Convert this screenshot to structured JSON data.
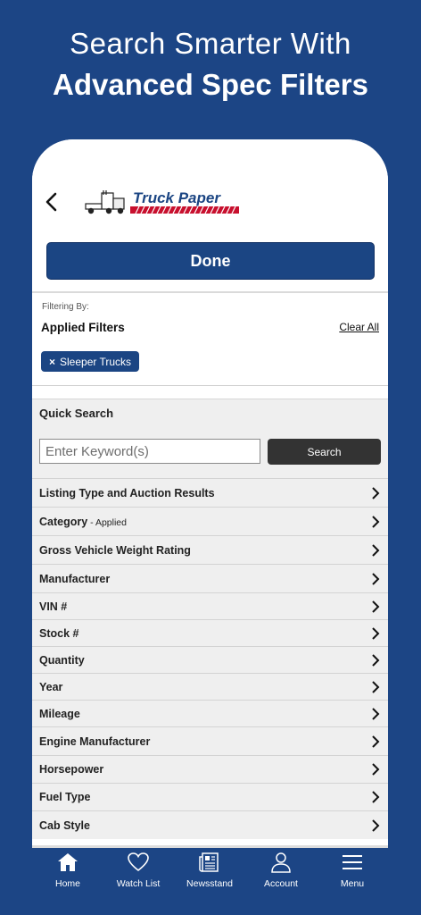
{
  "promo": {
    "line1": "Search Smarter With",
    "line2": "Advanced Spec Filters"
  },
  "header": {
    "logo_text": "Truck Paper",
    "done_label": "Done"
  },
  "filters": {
    "filtering_by_label": "Filtering By:",
    "applied_title": "Applied Filters",
    "clear_all": "Clear All",
    "chip_remove": "×",
    "chip_label": "Sleeper Trucks"
  },
  "quick_search": {
    "title": "Quick Search",
    "placeholder": "Enter Keyword(s)",
    "button_label": "Search"
  },
  "list_items": [
    {
      "label": "Listing Type and Auction Results",
      "sub": ""
    },
    {
      "label": "Category",
      "sub": " - Applied"
    },
    {
      "label": "Gross Vehicle Weight Rating",
      "sub": ""
    },
    {
      "label": "Manufacturer",
      "sub": ""
    },
    {
      "label": "VIN #",
      "sub": ""
    },
    {
      "label": "Stock #",
      "sub": ""
    },
    {
      "label": "Quantity",
      "sub": ""
    },
    {
      "label": "Year",
      "sub": ""
    },
    {
      "label": "Mileage",
      "sub": ""
    },
    {
      "label": "Engine Manufacturer",
      "sub": ""
    },
    {
      "label": "Horsepower",
      "sub": ""
    },
    {
      "label": "Fuel Type",
      "sub": ""
    },
    {
      "label": "Cab Style",
      "sub": ""
    }
  ],
  "tabbar": {
    "home": "Home",
    "watch_list": "Watch List",
    "newsstand": "Newsstand",
    "account": "Account",
    "menu": "Menu"
  },
  "colors": {
    "brand_blue": "#1c4585",
    "button_blue": "#1b4583",
    "logo_red": "#c8102e",
    "search_button": "#333333"
  }
}
